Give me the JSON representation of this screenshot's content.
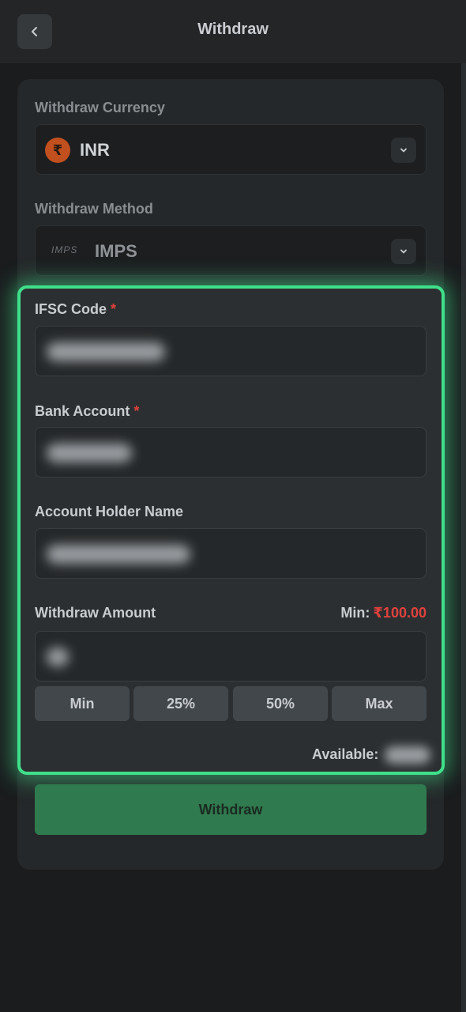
{
  "header": {
    "title": "Withdraw",
    "back_icon": "chevron-left-icon"
  },
  "currency": {
    "label": "Withdraw Currency",
    "value": "INR",
    "icon_glyph": "₹",
    "icon": "rupee-icon",
    "dropdown_icon": "chevron-down-icon"
  },
  "method": {
    "label": "Withdraw Method",
    "value": "IMPS",
    "logo_text": "IMPS",
    "dropdown_icon": "chevron-down-icon"
  },
  "form": {
    "ifsc_label": "IFSC Code",
    "bank_account_label": "Bank Account",
    "holder_name_label": "Account Holder Name",
    "amount_label": "Withdraw Amount",
    "required_mark": "*",
    "min_label": "Min:",
    "min_amount": "₹100.00",
    "chips": [
      "Min",
      "25%",
      "50%",
      "Max"
    ],
    "available_label": "Available:"
  },
  "actions": {
    "withdraw_label": "Withdraw"
  },
  "colors": {
    "accent_green": "#3fe08a",
    "button_green": "#2f7a4e",
    "required_red": "#e0413c",
    "rupee_orange": "#c1501e"
  }
}
